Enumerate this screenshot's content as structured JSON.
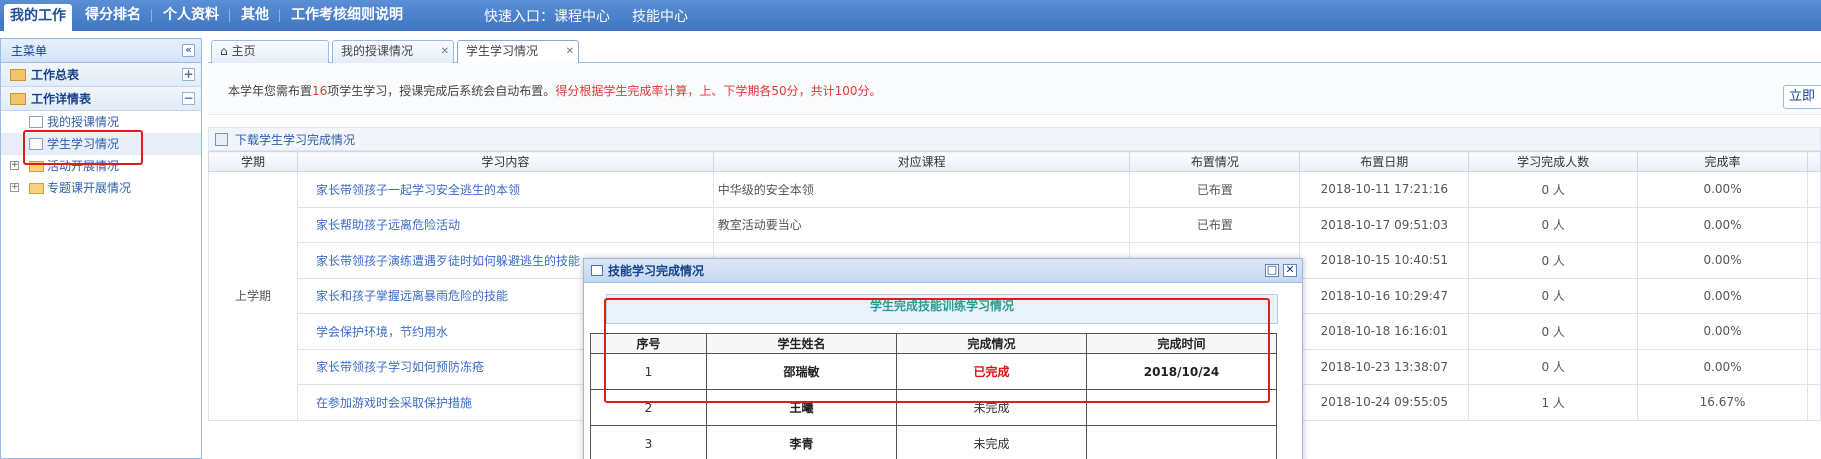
{
  "topnav": {
    "items": [
      "我的工作",
      "得分排名",
      "个人资料",
      "其他",
      "工作考核细则说明"
    ],
    "quick_label": "快速入口：课程中心",
    "quick_link2": "技能中心"
  },
  "sidebar": {
    "title": "主菜单",
    "groups": [
      "工作总表",
      "工作详情表"
    ],
    "items": [
      "我的授课情况",
      "学生学习情况",
      "活动开展情况",
      "专题课开展情况"
    ]
  },
  "tabs": [
    "主页",
    "我的授课情况",
    "学生学习情况"
  ],
  "notice": {
    "prefix": "本学年您需布置",
    "count": "16",
    "middle": "项学生学习，授课完成后系统会自动布置。",
    "red": "得分根据学生完成率计算，上、下学期各50分，共计100分。",
    "button": "立即"
  },
  "download_label": "下载学生学习完成情况",
  "table": {
    "headers": [
      "学期",
      "学习内容",
      "对应课程",
      "布置情况",
      "布置日期",
      "学习完成人数",
      "完成率"
    ],
    "semester": "上学期",
    "rows": [
      {
        "content": "家长带领孩子一起学习安全逃生的本领",
        "course": "中华级的安全本领",
        "status": "已布置",
        "date": "2018-10-11 17:21:16",
        "done": "0 人",
        "rate": "0.00%"
      },
      {
        "content": "家长帮助孩子远离危险活动",
        "course": "教室活动要当心",
        "status": "已布置",
        "date": "2018-10-17 09:51:03",
        "done": "0 人",
        "rate": "0.00%"
      },
      {
        "content": "家长带领孩子演练遭遇歹徒时如何躲避逃生的技能",
        "course": "",
        "status": "",
        "date": "2018-10-15 10:40:51",
        "done": "0 人",
        "rate": "0.00%"
      },
      {
        "content": "家长和孩子掌握远离暴雨危险的技能",
        "course": "",
        "status": "",
        "date": "2018-10-16 10:29:47",
        "done": "0 人",
        "rate": "0.00%"
      },
      {
        "content": "学会保护环境，节约用水",
        "course": "",
        "status": "",
        "date": "2018-10-18 16:16:01",
        "done": "0 人",
        "rate": "0.00%"
      },
      {
        "content": "家长带领孩子学习如何预防冻疮",
        "course": "",
        "status": "",
        "date": "2018-10-23 13:38:07",
        "done": "0 人",
        "rate": "0.00%"
      },
      {
        "content": "在参加游戏时会采取保护措施",
        "course": "",
        "status": "",
        "date": "2018-10-24 09:55:05",
        "done": "1 人",
        "rate": "16.67%"
      }
    ]
  },
  "dialog": {
    "title": "技能学习完成情况",
    "subtitle": "学生完成技能训练学习情况",
    "headers": [
      "序号",
      "学生姓名",
      "完成情况",
      "完成时间"
    ],
    "rows": [
      {
        "no": "1",
        "name": "邵瑞敏",
        "status": "已完成",
        "time": "2018/10/24"
      },
      {
        "no": "2",
        "name": "王曦",
        "status": "未完成",
        "time": ""
      },
      {
        "no": "3",
        "name": "李青",
        "status": "未完成",
        "time": ""
      }
    ]
  }
}
